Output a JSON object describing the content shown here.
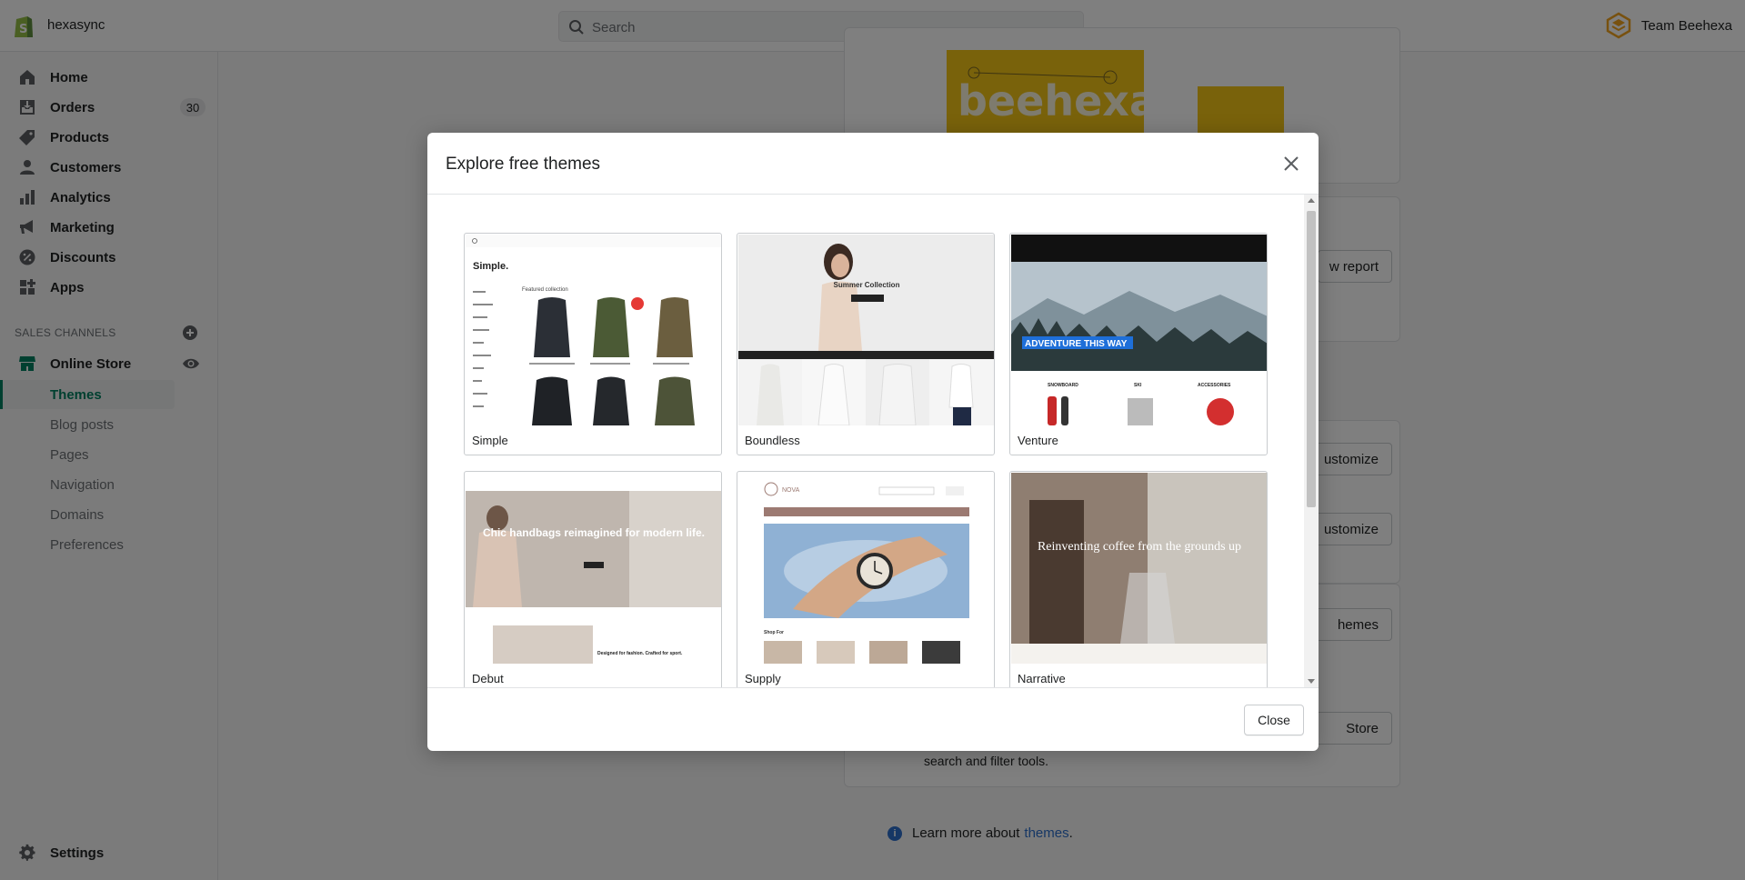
{
  "topbar": {
    "store_name": "hexasync",
    "search_placeholder": "Search",
    "team_name": "Team Beehexa"
  },
  "sidebar": {
    "items": [
      {
        "label": "Home",
        "icon": "home-icon"
      },
      {
        "label": "Orders",
        "icon": "orders-icon",
        "badge": "30"
      },
      {
        "label": "Products",
        "icon": "tag-icon"
      },
      {
        "label": "Customers",
        "icon": "person-icon"
      },
      {
        "label": "Analytics",
        "icon": "bar-chart-icon"
      },
      {
        "label": "Marketing",
        "icon": "megaphone-icon"
      },
      {
        "label": "Discounts",
        "icon": "discount-icon"
      },
      {
        "label": "Apps",
        "icon": "apps-icon"
      }
    ],
    "sales_channels_title": "SALES CHANNELS",
    "online_store": "Online Store",
    "sub_items": [
      "Themes",
      "Blog posts",
      "Pages",
      "Navigation",
      "Domains",
      "Preferences"
    ],
    "active_sub_item": "Themes",
    "settings": "Settings"
  },
  "background": {
    "view_report": "w report",
    "customize_1": "ustomize",
    "customize_2": "ustomize",
    "themes_btn": "hemes",
    "store_btn": "Store",
    "store_desc": "search and filter tools.",
    "learn_more_prefix": "Learn more about",
    "learn_more_link": "themes",
    "learn_more_suffix": "."
  },
  "modal": {
    "title": "Explore free themes",
    "close_label": "Close",
    "themes": [
      {
        "name": "Simple",
        "hero_title": "Simple.",
        "hero_subtitle": "Featured collection"
      },
      {
        "name": "Boundless",
        "hero_title": "Summer Collection"
      },
      {
        "name": "Venture",
        "hero_title": "ADVENTURE THIS WAY",
        "categories": [
          "SNOWBOARD",
          "SKI",
          "ACCESSORIES"
        ]
      },
      {
        "name": "Debut",
        "hero_title": "Chic handbags reimagined for modern life.",
        "tagline": "Designed for fashion. Crafted for sport."
      },
      {
        "name": "Supply",
        "hero_title": "NOVA",
        "section": "Shop For"
      },
      {
        "name": "Narrative",
        "hero_title": "Reinventing coffee from the grounds up"
      }
    ]
  },
  "colors": {
    "brand_green": "#008060",
    "overlay": "rgba(0,0,0,0.5)",
    "link_blue": "#2c6ecb",
    "venture_highlight": "#1e6fd9",
    "supply_bar": "#9c7a72"
  }
}
